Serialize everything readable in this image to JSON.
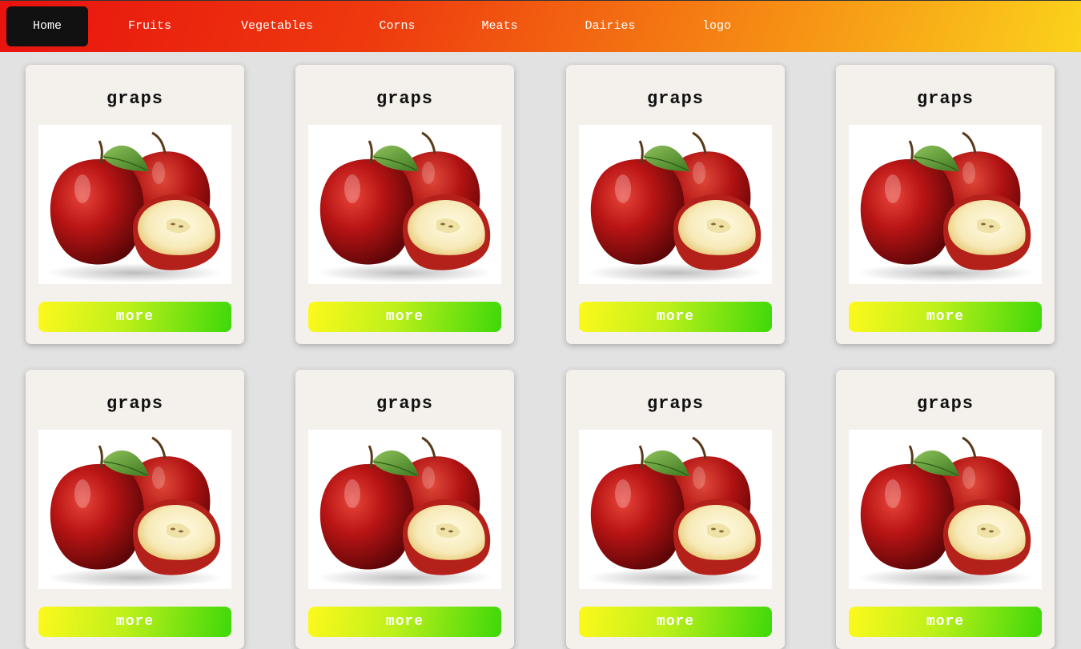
{
  "nav": {
    "items": [
      {
        "label": "Home",
        "active": true
      },
      {
        "label": "Fruits"
      },
      {
        "label": "Vegetables"
      },
      {
        "label": "Corns"
      },
      {
        "label": "Meats"
      },
      {
        "label": "Dairies"
      },
      {
        "label": "logo"
      }
    ]
  },
  "cards": [
    {
      "title": "graps",
      "button": "more",
      "image": "apple-icon"
    },
    {
      "title": "graps",
      "button": "more",
      "image": "apple-icon"
    },
    {
      "title": "graps",
      "button": "more",
      "image": "apple-icon"
    },
    {
      "title": "graps",
      "button": "more",
      "image": "apple-icon"
    },
    {
      "title": "graps",
      "button": "more",
      "image": "apple-icon"
    },
    {
      "title": "graps",
      "button": "more",
      "image": "apple-icon"
    },
    {
      "title": "graps",
      "button": "more",
      "image": "apple-icon"
    },
    {
      "title": "graps",
      "button": "more",
      "image": "apple-icon"
    }
  ],
  "colors": {
    "nav_gradient": [
      "#e8120f",
      "#fbd31c"
    ],
    "active_tab": "#111111",
    "button_gradient": [
      "#fdf91c",
      "#3ed80a"
    ],
    "card_bg": "#f4f1ec",
    "page_bg": "#e2e2e2"
  }
}
